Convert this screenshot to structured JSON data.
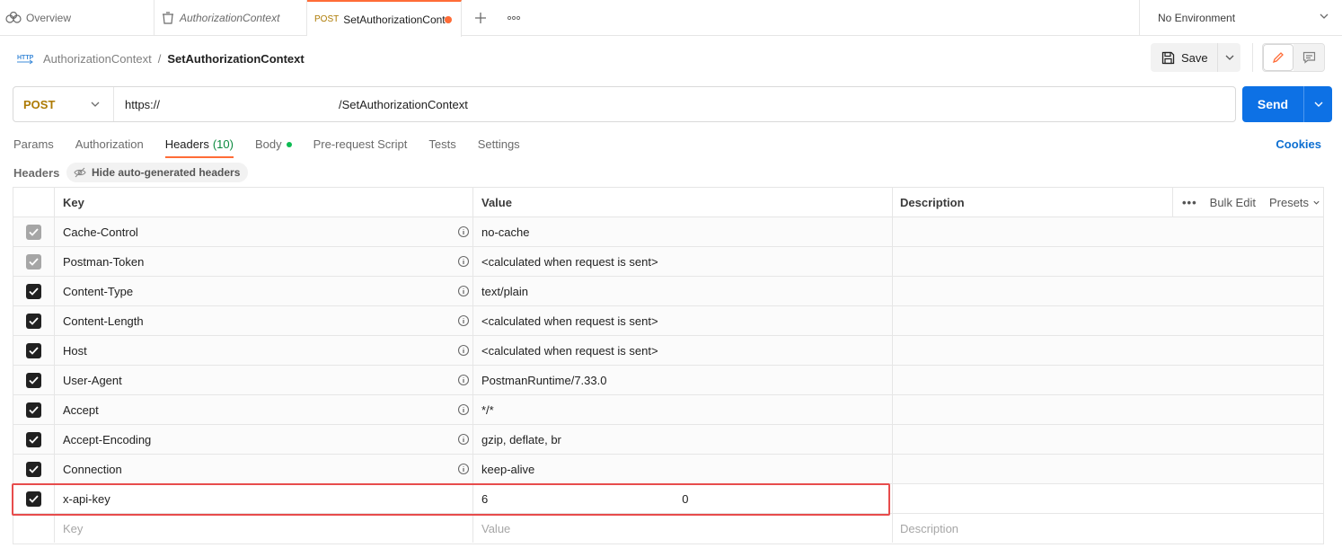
{
  "tabs": {
    "overview": "Overview",
    "collection": "AuthorizationContext",
    "active_method": "POST",
    "active_name": "SetAuthorizationCont"
  },
  "environment": {
    "selected": "No Environment"
  },
  "breadcrumb": {
    "parent": "AuthorizationContext",
    "separator": "/",
    "current": "SetAuthorizationContext"
  },
  "toolbar": {
    "save_label": "Save"
  },
  "request": {
    "method": "POST",
    "url_scheme": "https://",
    "url_path": "/SetAuthorizationContext",
    "send_label": "Send"
  },
  "request_tabs": {
    "params": "Params",
    "authorization": "Authorization",
    "headers": "Headers",
    "headers_count": "(10)",
    "body": "Body",
    "pre_request": "Pre-request Script",
    "tests": "Tests",
    "settings": "Settings",
    "cookies": "Cookies"
  },
  "headers_section": {
    "title": "Headers",
    "hide_auto_label": "Hide auto-generated headers"
  },
  "table": {
    "columns": {
      "key": "Key",
      "value": "Value",
      "description": "Description"
    },
    "bulk_edit": "Bulk Edit",
    "presets": "Presets",
    "rows": [
      {
        "key": "Cache-Control",
        "value": "no-cache"
      },
      {
        "key": "Postman-Token",
        "value": "<calculated when request is sent>"
      },
      {
        "key": "Content-Type",
        "value": "text/plain"
      },
      {
        "key": "Content-Length",
        "value": "<calculated when request is sent>"
      },
      {
        "key": "Host",
        "value": "<calculated when request is sent>"
      },
      {
        "key": "User-Agent",
        "value": "PostmanRuntime/7.33.0"
      },
      {
        "key": "Accept",
        "value": "*/*"
      },
      {
        "key": "Accept-Encoding",
        "value": "gzip, deflate, br"
      },
      {
        "key": "Connection",
        "value": "keep-alive"
      }
    ],
    "custom_row": {
      "key": "x-api-key",
      "value_start": "6",
      "value_end": "0"
    },
    "new_row": {
      "key_placeholder": "Key",
      "value_placeholder": "Value",
      "description_placeholder": "Description"
    }
  },
  "colors": {
    "accent": "#ff6c37",
    "send": "#0d71e5",
    "method": "#ad7a03",
    "highlight": "#e74c4c"
  }
}
